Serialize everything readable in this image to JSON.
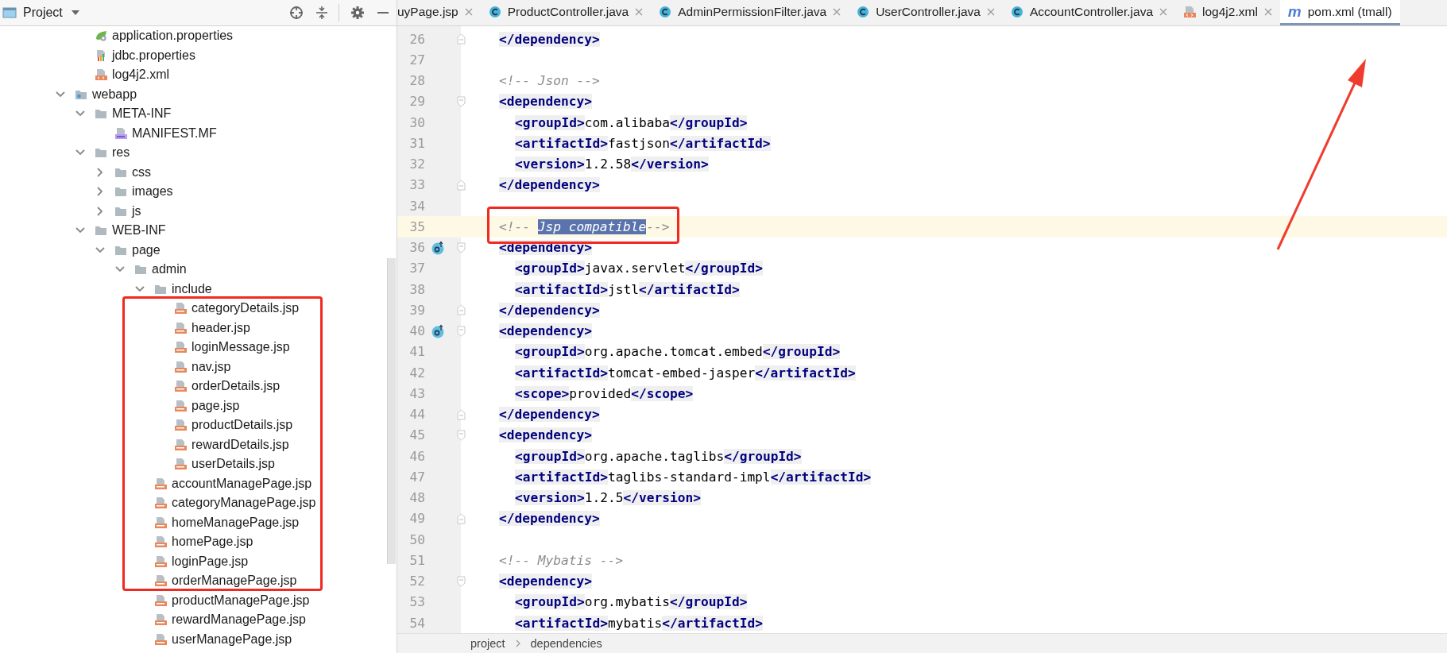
{
  "project_panel": {
    "title": "Project",
    "tree": [
      {
        "children": [
          {
            "label": "application.properties",
            "kind": "spring-config"
          },
          {
            "label": "jdbc.properties",
            "kind": "properties"
          },
          {
            "label": "log4j2.xml",
            "kind": "xml"
          }
        ]
      },
      {
        "label": "webapp",
        "kind": "web-folder",
        "expanded": true,
        "children": [
          {
            "label": "META-INF",
            "kind": "folder",
            "expanded": true,
            "children": [
              {
                "label": "MANIFEST.MF",
                "kind": "manifest"
              }
            ]
          },
          {
            "label": "res",
            "kind": "folder",
            "expanded": true,
            "children": [
              {
                "label": "css",
                "kind": "folder",
                "expanded": false
              },
              {
                "label": "images",
                "kind": "folder",
                "expanded": false
              },
              {
                "label": "js",
                "kind": "folder",
                "expanded": false
              }
            ]
          },
          {
            "label": "WEB-INF",
            "kind": "folder",
            "expanded": true,
            "children": [
              {
                "label": "page",
                "kind": "folder",
                "expanded": true,
                "children": [
                  {
                    "label": "admin",
                    "kind": "folder",
                    "expanded": true,
                    "children": [
                      {
                        "label": "include",
                        "kind": "folder",
                        "expanded": true,
                        "children": [
                          {
                            "label": "categoryDetails.jsp",
                            "kind": "jsp"
                          },
                          {
                            "label": "header.jsp",
                            "kind": "jsp"
                          },
                          {
                            "label": "loginMessage.jsp",
                            "kind": "jsp"
                          },
                          {
                            "label": "nav.jsp",
                            "kind": "jsp"
                          },
                          {
                            "label": "orderDetails.jsp",
                            "kind": "jsp"
                          },
                          {
                            "label": "page.jsp",
                            "kind": "jsp"
                          },
                          {
                            "label": "productDetails.jsp",
                            "kind": "jsp"
                          },
                          {
                            "label": "rewardDetails.jsp",
                            "kind": "jsp"
                          },
                          {
                            "label": "userDetails.jsp",
                            "kind": "jsp"
                          }
                        ]
                      },
                      {
                        "label": "accountManagePage.jsp",
                        "kind": "jsp"
                      },
                      {
                        "label": "categoryManagePage.jsp",
                        "kind": "jsp"
                      },
                      {
                        "label": "homeManagePage.jsp",
                        "kind": "jsp"
                      },
                      {
                        "label": "homePage.jsp",
                        "kind": "jsp"
                      },
                      {
                        "label": "loginPage.jsp",
                        "kind": "jsp"
                      },
                      {
                        "label": "orderManagePage.jsp",
                        "kind": "jsp"
                      },
                      {
                        "label": "productManagePage.jsp",
                        "kind": "jsp"
                      },
                      {
                        "label": "rewardManagePage.jsp",
                        "kind": "jsp"
                      },
                      {
                        "label": "userManagePage.jsp",
                        "kind": "jsp"
                      }
                    ]
                  }
                ]
              }
            ]
          }
        ]
      }
    ]
  },
  "editor": {
    "tabs": [
      {
        "label": "uyPage.jsp",
        "selected": false,
        "closable": true
      },
      {
        "label": "ProductController.java",
        "kind": "java-class",
        "selected": false,
        "closable": true
      },
      {
        "label": "AdminPermissionFilter.java",
        "kind": "java-class",
        "selected": false,
        "closable": true
      },
      {
        "label": "UserController.java",
        "kind": "java-class",
        "selected": false,
        "closable": true
      },
      {
        "label": "AccountController.java",
        "kind": "java-class",
        "selected": false,
        "closable": true
      },
      {
        "label": "log4j2.xml",
        "kind": "xml",
        "selected": false,
        "closable": true
      },
      {
        "label": "pom.xml (tmall)",
        "glyph": "m",
        "selected": true,
        "closable": false
      }
    ],
    "lines": [
      {
        "number": "26",
        "indented": false,
        "current": false,
        "overridden": false,
        "fold_open": false,
        "fold_close": true,
        "tokens": [
          {
            "kind": "tag",
            "text": "</dependency>"
          }
        ]
      },
      {
        "number": "27",
        "current": false,
        "overridden": false,
        "fold_open": false,
        "fold_close": false
      },
      {
        "number": "28",
        "indented": false,
        "current": false,
        "overridden": false,
        "fold_open": false,
        "fold_close": false,
        "tokens": [
          {
            "kind": "comment",
            "text": "<!-- Json -->"
          }
        ]
      },
      {
        "number": "29",
        "indented": false,
        "current": false,
        "overridden": false,
        "fold_open": true,
        "fold_close": false,
        "tokens": [
          {
            "kind": "tag",
            "text": "<dependency>"
          }
        ]
      },
      {
        "number": "30",
        "indented": true,
        "current": false,
        "overridden": false,
        "fold_open": false,
        "fold_close": false,
        "tokens": [
          {
            "kind": "tag",
            "text": "<groupId>"
          },
          {
            "kind": "text",
            "text": "com.alibaba"
          },
          {
            "kind": "tag",
            "text": "</groupId>"
          }
        ]
      },
      {
        "number": "31",
        "indented": true,
        "current": false,
        "overridden": false,
        "fold_open": false,
        "fold_close": false,
        "tokens": [
          {
            "kind": "tag",
            "text": "<artifactId>"
          },
          {
            "kind": "text",
            "text": "fastjson"
          },
          {
            "kind": "tag",
            "text": "</artifactId>"
          }
        ]
      },
      {
        "number": "32",
        "indented": true,
        "current": false,
        "overridden": false,
        "fold_open": false,
        "fold_close": false,
        "tokens": [
          {
            "kind": "tag",
            "text": "<version>"
          },
          {
            "kind": "text",
            "text": "1.2.58"
          },
          {
            "kind": "tag",
            "text": "</version>"
          }
        ]
      },
      {
        "number": "33",
        "indented": false,
        "current": false,
        "overridden": false,
        "fold_open": false,
        "fold_close": true,
        "tokens": [
          {
            "kind": "tag",
            "text": "</dependency>"
          }
        ]
      },
      {
        "number": "34",
        "current": false,
        "overridden": false,
        "fold_open": false,
        "fold_close": false
      },
      {
        "number": "35",
        "indented": false,
        "current": true,
        "overridden": false,
        "fold_open": false,
        "fold_close": false,
        "tokens": [
          {
            "kind": "comment",
            "text": "<!-- "
          },
          {
            "kind": "selection",
            "text": "Jsp compatible"
          },
          {
            "kind": "comment",
            "text": "-->"
          }
        ]
      },
      {
        "number": "36",
        "indented": false,
        "current": false,
        "overridden": true,
        "fold_open": true,
        "fold_close": false,
        "tokens": [
          {
            "kind": "tag",
            "text": "<dependency>"
          }
        ]
      },
      {
        "number": "37",
        "indented": true,
        "current": false,
        "overridden": false,
        "fold_open": false,
        "fold_close": false,
        "tokens": [
          {
            "kind": "tag",
            "text": "<groupId>"
          },
          {
            "kind": "text",
            "text": "javax.servlet"
          },
          {
            "kind": "tag",
            "text": "</groupId>"
          }
        ]
      },
      {
        "number": "38",
        "indented": true,
        "current": false,
        "overridden": false,
        "fold_open": false,
        "fold_close": false,
        "tokens": [
          {
            "kind": "tag",
            "text": "<artifactId>"
          },
          {
            "kind": "text",
            "text": "jstl"
          },
          {
            "kind": "tag",
            "text": "</artifactId>"
          }
        ]
      },
      {
        "number": "39",
        "indented": false,
        "current": false,
        "overridden": false,
        "fold_open": false,
        "fold_close": true,
        "tokens": [
          {
            "kind": "tag",
            "text": "</dependency>"
          }
        ]
      },
      {
        "number": "40",
        "indented": false,
        "current": false,
        "overridden": true,
        "fold_open": true,
        "fold_close": false,
        "tokens": [
          {
            "kind": "tag",
            "text": "<dependency>"
          }
        ]
      },
      {
        "number": "41",
        "indented": true,
        "current": false,
        "overridden": false,
        "fold_open": false,
        "fold_close": false,
        "tokens": [
          {
            "kind": "tag",
            "text": "<groupId>"
          },
          {
            "kind": "text",
            "text": "org.apache.tomcat.embed"
          },
          {
            "kind": "tag",
            "text": "</groupId>"
          }
        ]
      },
      {
        "number": "42",
        "indented": true,
        "current": false,
        "overridden": false,
        "fold_open": false,
        "fold_close": false,
        "tokens": [
          {
            "kind": "tag",
            "text": "<artifactId>"
          },
          {
            "kind": "text",
            "text": "tomcat-embed-jasper"
          },
          {
            "kind": "tag",
            "text": "</artifactId>"
          }
        ]
      },
      {
        "number": "43",
        "indented": true,
        "current": false,
        "overridden": false,
        "fold_open": false,
        "fold_close": false,
        "tokens": [
          {
            "kind": "tag",
            "text": "<scope>"
          },
          {
            "kind": "text",
            "text": "provided"
          },
          {
            "kind": "tag",
            "text": "</scope>"
          }
        ]
      },
      {
        "number": "44",
        "indented": false,
        "current": false,
        "overridden": false,
        "fold_open": false,
        "fold_close": true,
        "tokens": [
          {
            "kind": "tag",
            "text": "</dependency>"
          }
        ]
      },
      {
        "number": "45",
        "indented": false,
        "current": false,
        "overridden": false,
        "fold_open": true,
        "fold_close": false,
        "tokens": [
          {
            "kind": "tag",
            "text": "<dependency>"
          }
        ]
      },
      {
        "number": "46",
        "indented": true,
        "current": false,
        "overridden": false,
        "fold_open": false,
        "fold_close": false,
        "tokens": [
          {
            "kind": "tag",
            "text": "<groupId>"
          },
          {
            "kind": "text",
            "text": "org.apache.taglibs"
          },
          {
            "kind": "tag",
            "text": "</groupId>"
          }
        ]
      },
      {
        "number": "47",
        "indented": true,
        "current": false,
        "overridden": false,
        "fold_open": false,
        "fold_close": false,
        "tokens": [
          {
            "kind": "tag",
            "text": "<artifactId>"
          },
          {
            "kind": "text",
            "text": "taglibs-standard-impl"
          },
          {
            "kind": "tag",
            "text": "</artifactId>"
          }
        ]
      },
      {
        "number": "48",
        "indented": true,
        "current": false,
        "overridden": false,
        "fold_open": false,
        "fold_close": false,
        "tokens": [
          {
            "kind": "tag",
            "text": "<version>"
          },
          {
            "kind": "text",
            "text": "1.2.5"
          },
          {
            "kind": "tag",
            "text": "</version>"
          }
        ]
      },
      {
        "number": "49",
        "indented": false,
        "current": false,
        "overridden": false,
        "fold_open": false,
        "fold_close": true,
        "tokens": [
          {
            "kind": "tag",
            "text": "</dependency>"
          }
        ]
      },
      {
        "number": "50",
        "current": false,
        "overridden": false,
        "fold_open": false,
        "fold_close": false
      },
      {
        "number": "51",
        "indented": false,
        "current": false,
        "overridden": false,
        "fold_open": false,
        "fold_close": false,
        "tokens": [
          {
            "kind": "comment",
            "text": "<!-- Mybatis -->"
          }
        ]
      },
      {
        "number": "52",
        "indented": false,
        "current": false,
        "overridden": false,
        "fold_open": true,
        "fold_close": false,
        "tokens": [
          {
            "kind": "tag",
            "text": "<dependency>"
          }
        ]
      },
      {
        "number": "53",
        "indented": true,
        "current": false,
        "overridden": false,
        "fold_open": false,
        "fold_close": false,
        "tokens": [
          {
            "kind": "tag",
            "text": "<groupId>"
          },
          {
            "kind": "text",
            "text": "org.mybatis"
          },
          {
            "kind": "tag",
            "text": "</groupId>"
          }
        ]
      },
      {
        "number": "54",
        "indented": true,
        "current": false,
        "overridden": false,
        "fold_open": false,
        "fold_close": false,
        "tokens": [
          {
            "kind": "tag",
            "text": "<artifactId>"
          },
          {
            "kind": "text",
            "text": "mybatis"
          },
          {
            "kind": "tag",
            "text": "</artifactId>"
          }
        ]
      }
    ],
    "breadcrumbs": [
      "project",
      "dependencies"
    ]
  }
}
